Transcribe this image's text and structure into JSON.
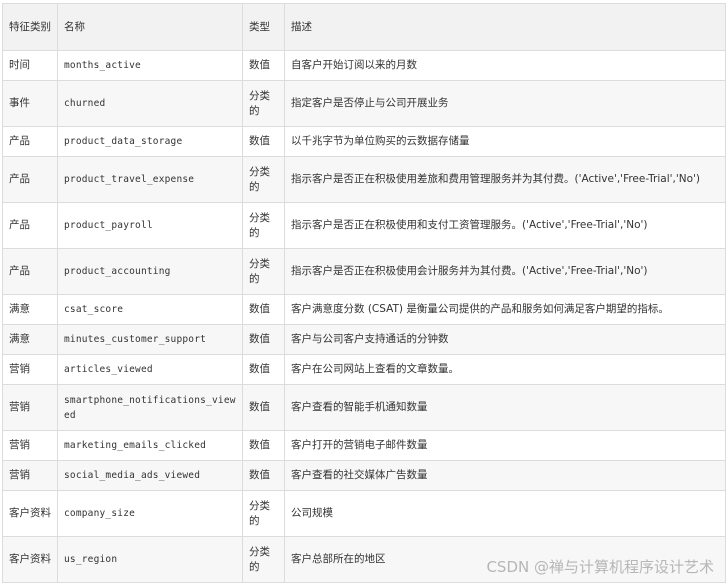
{
  "table": {
    "headers": [
      "特征类别",
      "名称",
      "类型",
      "描述"
    ],
    "rows": [
      {
        "category": "时间",
        "name": "months_active",
        "type": "数值",
        "desc": "自客户开始订阅以来的月数"
      },
      {
        "category": "事件",
        "name": "churned",
        "type": "分类的",
        "desc": "指定客户是否停止与公司开展业务"
      },
      {
        "category": "产品",
        "name": "product_data_storage",
        "type": "数值",
        "desc": "以千兆字节为单位购买的云数据存储量"
      },
      {
        "category": "产品",
        "name": "product_travel_expense",
        "type": "分类的",
        "desc": "指示客户是否正在积极使用差旅和费用管理服务并为其付费。('Active','Free-Trial','No')"
      },
      {
        "category": "产品",
        "name": "product_payroll",
        "type": "分类的",
        "desc": "指示客户是否正在积极使用和支付工资管理服务。('Active','Free-Trial','No')"
      },
      {
        "category": "产品",
        "name": "product_accounting",
        "type": "分类的",
        "desc": "指示客户是否正在积极使用会计服务并为其付费。('Active','Free-Trial','No')"
      },
      {
        "category": "满意",
        "name": "csat_score",
        "type": "数值",
        "desc": "客户满意度分数 (CSAT) 是衡量公司提供的产品和服务如何满足客户期望的指标。"
      },
      {
        "category": "满意",
        "name": "minutes_customer_support",
        "type": "数值",
        "desc": "客户与公司客户支持通话的分钟数"
      },
      {
        "category": "营销",
        "name": "articles_viewed",
        "type": "数值",
        "desc": "客户在公司网站上查看的文章数量。"
      },
      {
        "category": "营销",
        "name": "smartphone_notifications_viewed",
        "type": "数值",
        "desc": "客户查看的智能手机通知数量"
      },
      {
        "category": "营销",
        "name": "marketing_emails_clicked",
        "type": "数值",
        "desc": "客户打开的营销电子邮件数量"
      },
      {
        "category": "营销",
        "name": "social_media_ads_viewed",
        "type": "数值",
        "desc": "客户查看的社交媒体广告数量"
      },
      {
        "category": "客户资料",
        "name": "company_size",
        "type": "分类的",
        "desc": "公司规模"
      },
      {
        "category": "客户资料",
        "name": "us_region",
        "type": "分类的",
        "desc": "客户总部所在的地区"
      }
    ]
  },
  "watermark": "CSDN @禅与计算机程序设计艺术"
}
